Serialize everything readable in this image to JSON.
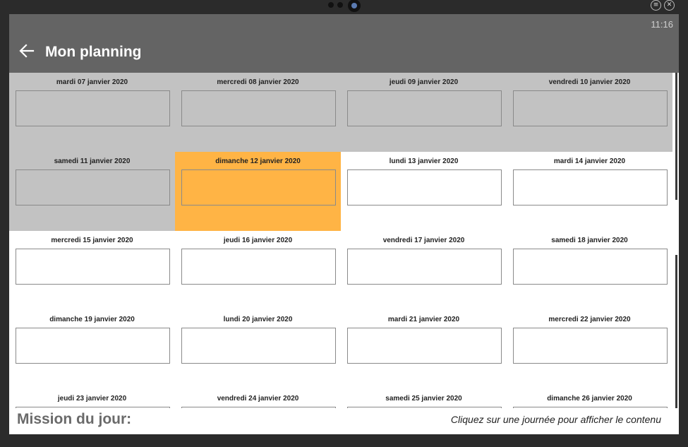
{
  "window": {
    "menu_icon": "menu-icon",
    "close_icon": "close-icon"
  },
  "header": {
    "time": "11:16",
    "title": "Mon planning",
    "back_icon": "arrow-left-icon"
  },
  "calendar": {
    "days": [
      {
        "label": "mardi 07 janvier 2020",
        "state": "past"
      },
      {
        "label": "mercredi 08 janvier 2020",
        "state": "past"
      },
      {
        "label": "jeudi 09 janvier 2020",
        "state": "past"
      },
      {
        "label": "vendredi 10 janvier 2020",
        "state": "past"
      },
      {
        "label": "samedi 11 janvier 2020",
        "state": "past"
      },
      {
        "label": "dimanche 12 janvier 2020",
        "state": "today"
      },
      {
        "label": "lundi 13 janvier 2020",
        "state": "future"
      },
      {
        "label": "mardi 14 janvier 2020",
        "state": "future"
      },
      {
        "label": "mercredi 15 janvier 2020",
        "state": "future"
      },
      {
        "label": "jeudi 16 janvier 2020",
        "state": "future"
      },
      {
        "label": "vendredi 17 janvier 2020",
        "state": "future"
      },
      {
        "label": "samedi 18 janvier 2020",
        "state": "future"
      },
      {
        "label": "dimanche 19 janvier 2020",
        "state": "future"
      },
      {
        "label": "lundi 20 janvier 2020",
        "state": "future"
      },
      {
        "label": "mardi 21 janvier 2020",
        "state": "future"
      },
      {
        "label": "mercredi 22 janvier 2020",
        "state": "future"
      },
      {
        "label": "jeudi 23 janvier 2020",
        "state": "future"
      },
      {
        "label": "vendredi 24 janvier 2020",
        "state": "future"
      },
      {
        "label": "samedi 25 janvier 2020",
        "state": "future"
      },
      {
        "label": "dimanche 26 janvier 2020",
        "state": "future"
      }
    ]
  },
  "colors": {
    "appbar": "#646464",
    "past": "#c2c2c2",
    "today": "#ffb445",
    "future": "#ffffff"
  },
  "footer": {
    "mission_label": "Mission du jour:",
    "hint": "Cliquez sur une journée pour afficher le contenu"
  }
}
